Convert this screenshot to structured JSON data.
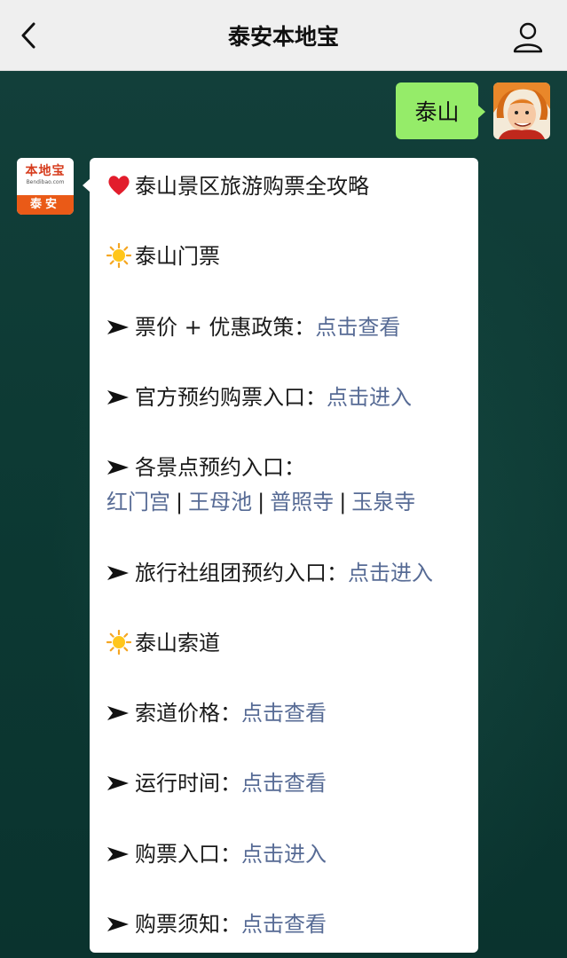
{
  "header": {
    "title": "泰安本地宝",
    "back_icon": "chevron-left-icon",
    "profile_icon": "person-icon"
  },
  "user_message": {
    "text": "泰山"
  },
  "bot": {
    "avatar": {
      "brand": "本地宝",
      "brand_en": "Bendibao.com",
      "city": "泰安"
    },
    "heading": "泰山景区旅游购票全攻略",
    "section_ticket": "泰山门票",
    "rows": {
      "price_label": "票价 + 优惠政策：",
      "price_link": "点击查看",
      "official_label": "官方预约购票入口：",
      "official_link": "点击进入",
      "spots_label": "各景点预约入口：",
      "spots": [
        "红门宫",
        "王母池",
        "普照寺",
        "玉泉寺"
      ],
      "spots_sep": "|",
      "agency_label": "旅行社组团预约入口：",
      "agency_link": "点击进入"
    },
    "section_cable": "泰山索道",
    "cable_rows": {
      "price_label": "索道价格：",
      "price_link": "点击查看",
      "hours_label": "运行时间：",
      "hours_link": "点击查看",
      "buy_label": "购票入口：",
      "buy_link": "点击进入",
      "notice_label": "购票须知：",
      "notice_link": "点击查看"
    }
  },
  "colors": {
    "topbar": "#efefef",
    "user_bubble": "#95ec69",
    "link": "#576b95",
    "chat_bg": "#0d3a34",
    "brand_orange": "#ea5a17"
  }
}
